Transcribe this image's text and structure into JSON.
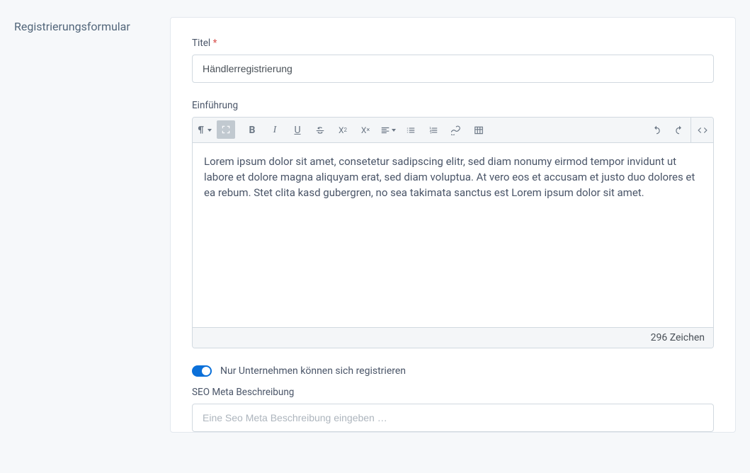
{
  "sidebar": {
    "title": "Registrierungsformular"
  },
  "fields": {
    "title": {
      "label": "Titel",
      "required_mark": "*",
      "value": "Händlerregistrierung"
    },
    "intro": {
      "label": "Einführung",
      "content": "Lorem ipsum dolor sit amet, consetetur sadipscing elitr, sed diam nonumy eirmod tempor invidunt ut labore et dolore magna aliquyam erat, sed diam voluptua. At vero eos et accusam et justo duo dolores et ea rebum. Stet clita kasd gubergren, no sea takimata sanctus est Lorem ipsum dolor sit amet.",
      "char_count": "296 Zeichen"
    },
    "company_only": {
      "label": "Nur Unternehmen können sich registrieren",
      "enabled": true
    },
    "seo": {
      "label": "SEO Meta Beschreibung",
      "placeholder": "Eine Seo Meta Beschreibung eingeben …"
    }
  },
  "toolbar": {
    "icons": {
      "paragraph": "paragraph-format-icon",
      "fullscreen": "fullscreen-icon",
      "bold": "bold-icon",
      "italic": "italic-icon",
      "underline": "underline-icon",
      "strikethrough": "strikethrough-icon",
      "superscript": "superscript-icon",
      "clearformat": "clear-format-icon",
      "align": "align-icon",
      "listul": "unordered-list-icon",
      "listol": "ordered-list-icon",
      "link": "link-icon",
      "table": "table-icon",
      "undo": "undo-icon",
      "redo": "redo-icon",
      "codeview": "code-view-icon"
    }
  }
}
